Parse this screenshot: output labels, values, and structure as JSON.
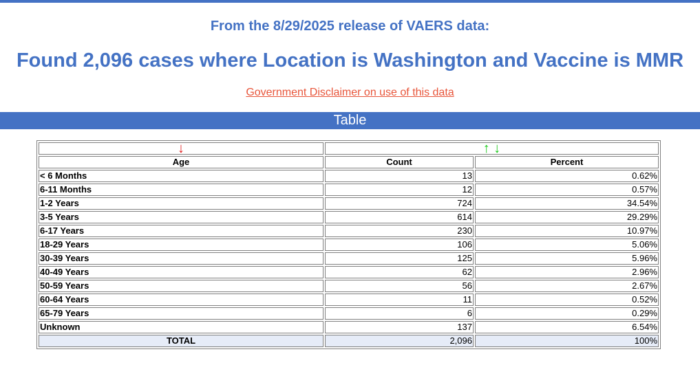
{
  "release_text": "From the 8/29/2025 release of VAERS data:",
  "headline": "Found 2,096 cases where Location is Washington and Vaccine is MMR",
  "disclaimer_link": "Government Disclaimer on use of this data",
  "section_title": "Table",
  "sort_arrows": {
    "age_down": "↓",
    "count_up": "↑",
    "count_down": "↓"
  },
  "table": {
    "headers": {
      "age": "Age",
      "count": "Count",
      "percent": "Percent"
    },
    "rows": [
      {
        "age": "< 6 Months",
        "count": "13",
        "percent": "0.62%"
      },
      {
        "age": "6-11 Months",
        "count": "12",
        "percent": "0.57%"
      },
      {
        "age": "1-2 Years",
        "count": "724",
        "percent": "34.54%"
      },
      {
        "age": "3-5 Years",
        "count": "614",
        "percent": "29.29%"
      },
      {
        "age": "6-17 Years",
        "count": "230",
        "percent": "10.97%"
      },
      {
        "age": "18-29 Years",
        "count": "106",
        "percent": "5.06%"
      },
      {
        "age": "30-39 Years",
        "count": "125",
        "percent": "5.96%"
      },
      {
        "age": "40-49 Years",
        "count": "62",
        "percent": "2.96%"
      },
      {
        "age": "50-59 Years",
        "count": "56",
        "percent": "2.67%"
      },
      {
        "age": "60-64 Years",
        "count": "11",
        "percent": "0.52%"
      },
      {
        "age": "65-79 Years",
        "count": "6",
        "percent": "0.29%"
      },
      {
        "age": "Unknown",
        "count": "137",
        "percent": "6.54%"
      }
    ],
    "total": {
      "label": "TOTAL",
      "count": "2,096",
      "percent": "100%"
    }
  },
  "colors": {
    "accent": "#4472c4",
    "link": "#e8553a",
    "sort_down_active": "#e02020",
    "sort_available": "#19c919"
  }
}
